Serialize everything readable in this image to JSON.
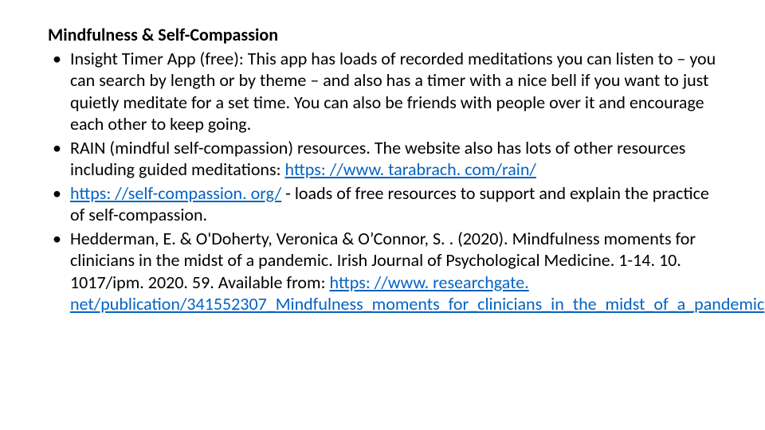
{
  "heading": "Mindfulness & Self-Compassion",
  "bullets": {
    "b1": "Insight Timer App (free): This app has loads of recorded meditations you can listen to – you can search by length or by theme – and also has a timer with a nice bell if you want to just quietly meditate for a set time.  You can also be friends with people over it and encourage each other to keep going.",
    "b2_pre": "RAIN (mindful self-compassion) resources. The website also has lots of other resources including guided meditations: ",
    "b2_link": "https: //www. tarabrach. com/rain/",
    "b3_link": "https: //self-compassion. org/",
    "b3_post": " - loads of free resources to support and explain the practice of self-compassion.",
    "b4_pre": "Hedderman, E. & O'Doherty, Veronica & O’Connor, S. . (2020). Mindfulness moments for clinicians in the midst of a pandemic. Irish Journal of Psychological Medicine. 1-14. 10. 1017/ipm. 2020. 59.  Available from: ",
    "b4_link": "https: //www. researchgate. net/publication/341552307_Mindfulness_moments_for_clinicians_in_the_midst_of_a_pandemic"
  }
}
